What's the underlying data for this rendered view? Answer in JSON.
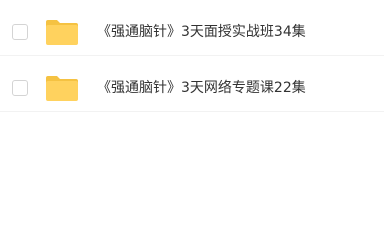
{
  "files": [
    {
      "name": "《强通脑针》3天面授实战班34集",
      "type": "folder-icon",
      "selected": false
    },
    {
      "name": "《强通脑针》3天网络专题课22集",
      "type": "folder-icon",
      "selected": false
    }
  ],
  "colors": {
    "folder_body": "#FFD25E",
    "folder_back": "#F5C242",
    "text": "#333333",
    "checkbox_border": "#D4D4D4"
  }
}
